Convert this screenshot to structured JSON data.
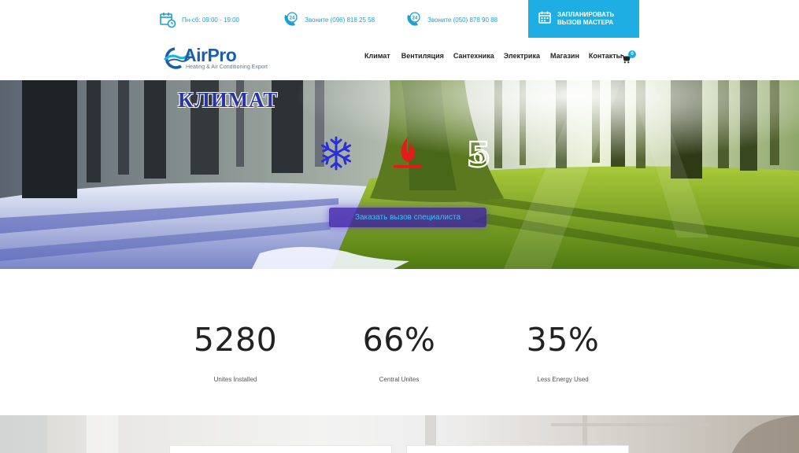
{
  "topbar": {
    "hours": "Пн-сб: 09:00 - 19:00",
    "phone1": "Звоните (096) 818 25 58",
    "phone2": "Звоните (050) 878 90 88",
    "cta_label": "ЗАПЛАНИРОВАТЬ ВЫЗОВ МАСТЕРА",
    "phone_badge": "24"
  },
  "logo": {
    "name": "AirPro",
    "tagline": "Heating & Air Conditioning Export"
  },
  "nav": {
    "items": [
      "Климат",
      "Вентиляция",
      "Сантехника",
      "Электрика",
      "Магазин",
      "Контакты"
    ],
    "cart_count": "0"
  },
  "hero": {
    "title": "КЛИМАТ",
    "button": "Заказать вызов специалиста",
    "icons": [
      "snowflake-icon",
      "flame-icon",
      "five-icon"
    ],
    "five_glyph": "5"
  },
  "stats": [
    {
      "value": "5280",
      "label": "Unites Installed"
    },
    {
      "value": "66%",
      "label": "Central Unites"
    },
    {
      "value": "35%",
      "label": "Less Energy Used"
    }
  ],
  "colors": {
    "accent": "#1eaee4",
    "logo_blue": "#1a5fa8",
    "hero_title": "#2a36a8",
    "hero_button": "#3c1eaa"
  }
}
